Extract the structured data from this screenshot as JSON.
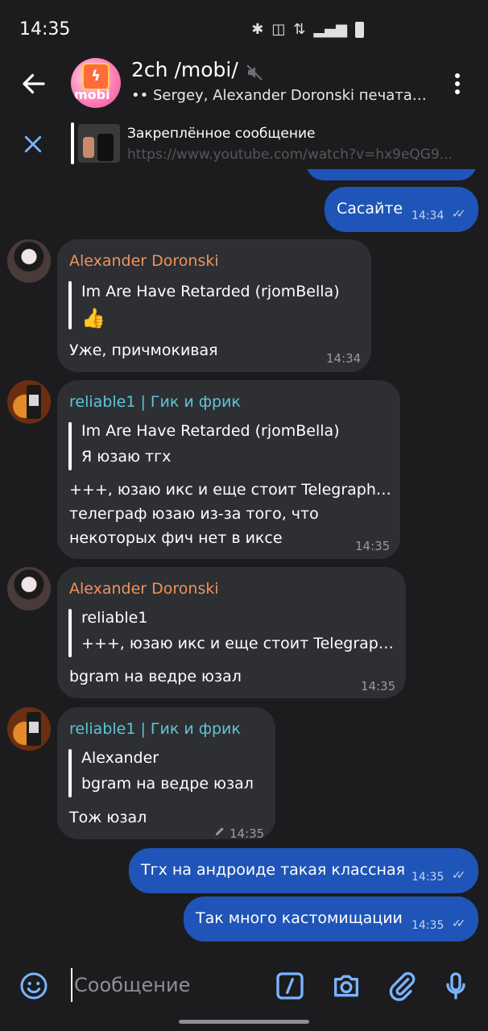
{
  "status": {
    "time": "14:35"
  },
  "header": {
    "title": "2ch /mobi/",
    "subtitle": "•• Sergey, Alexander Doronski печата…",
    "avatar_text": "mobi"
  },
  "pinned": {
    "title": "Закреплённое сообщение",
    "text": "https://www.youtube.com/watch?v=hx9eQG9..."
  },
  "messages": [
    {
      "type": "out",
      "text": "Сасайте",
      "time": "14:34"
    },
    {
      "type": "in",
      "sender": "Alexander Doronski",
      "quote_author": "Im Are Have Retarded (rjomBella)",
      "quote_text": "👍",
      "text": "Уже, причмокивая",
      "time": "14:34"
    },
    {
      "type": "in",
      "sender": "reliable1 | Гик и фрик",
      "quote_author": "Im Are Have Retarded (rjomBella)",
      "quote_text": "Я юзаю тгх",
      "text": "+++, юзаю икс и еще стоит Telegraph… телеграф юзаю из-за того, что некоторых фич нет в иксе",
      "text_lines": [
        "+++, юзаю икс и еще стоит Telegraph…",
        "телеграф юзаю из-за того, что",
        "некоторых фич нет в иксе"
      ],
      "time": "14:35"
    },
    {
      "type": "in",
      "sender": "Alexander Doronski",
      "quote_author": "reliable1",
      "quote_text": "+++, юзаю икс и еще стоит Telegrap…",
      "text": "bgram на ведре юзал",
      "time": "14:35"
    },
    {
      "type": "in",
      "sender": "reliable1 | Гик и фрик",
      "quote_author": "Alexander",
      "quote_text": "bgram на ведре юзал",
      "text": "Тож юзал",
      "time": "14:35",
      "edited": true
    },
    {
      "type": "out",
      "text": "Тгх на андроиде такая классная",
      "time": "14:35"
    },
    {
      "type": "out",
      "text": "Так много кастомищации",
      "time": "14:35"
    }
  ],
  "composer": {
    "placeholder": "Сообщение"
  },
  "colors": {
    "background": "#1c1c1e",
    "outgoing_bubble": "#1f55b8",
    "incoming_bubble": "#2e2f33",
    "sender_alexander": "#f0925c",
    "sender_reliable": "#5cc6d8",
    "accent_icons": "#7ab4ff"
  }
}
